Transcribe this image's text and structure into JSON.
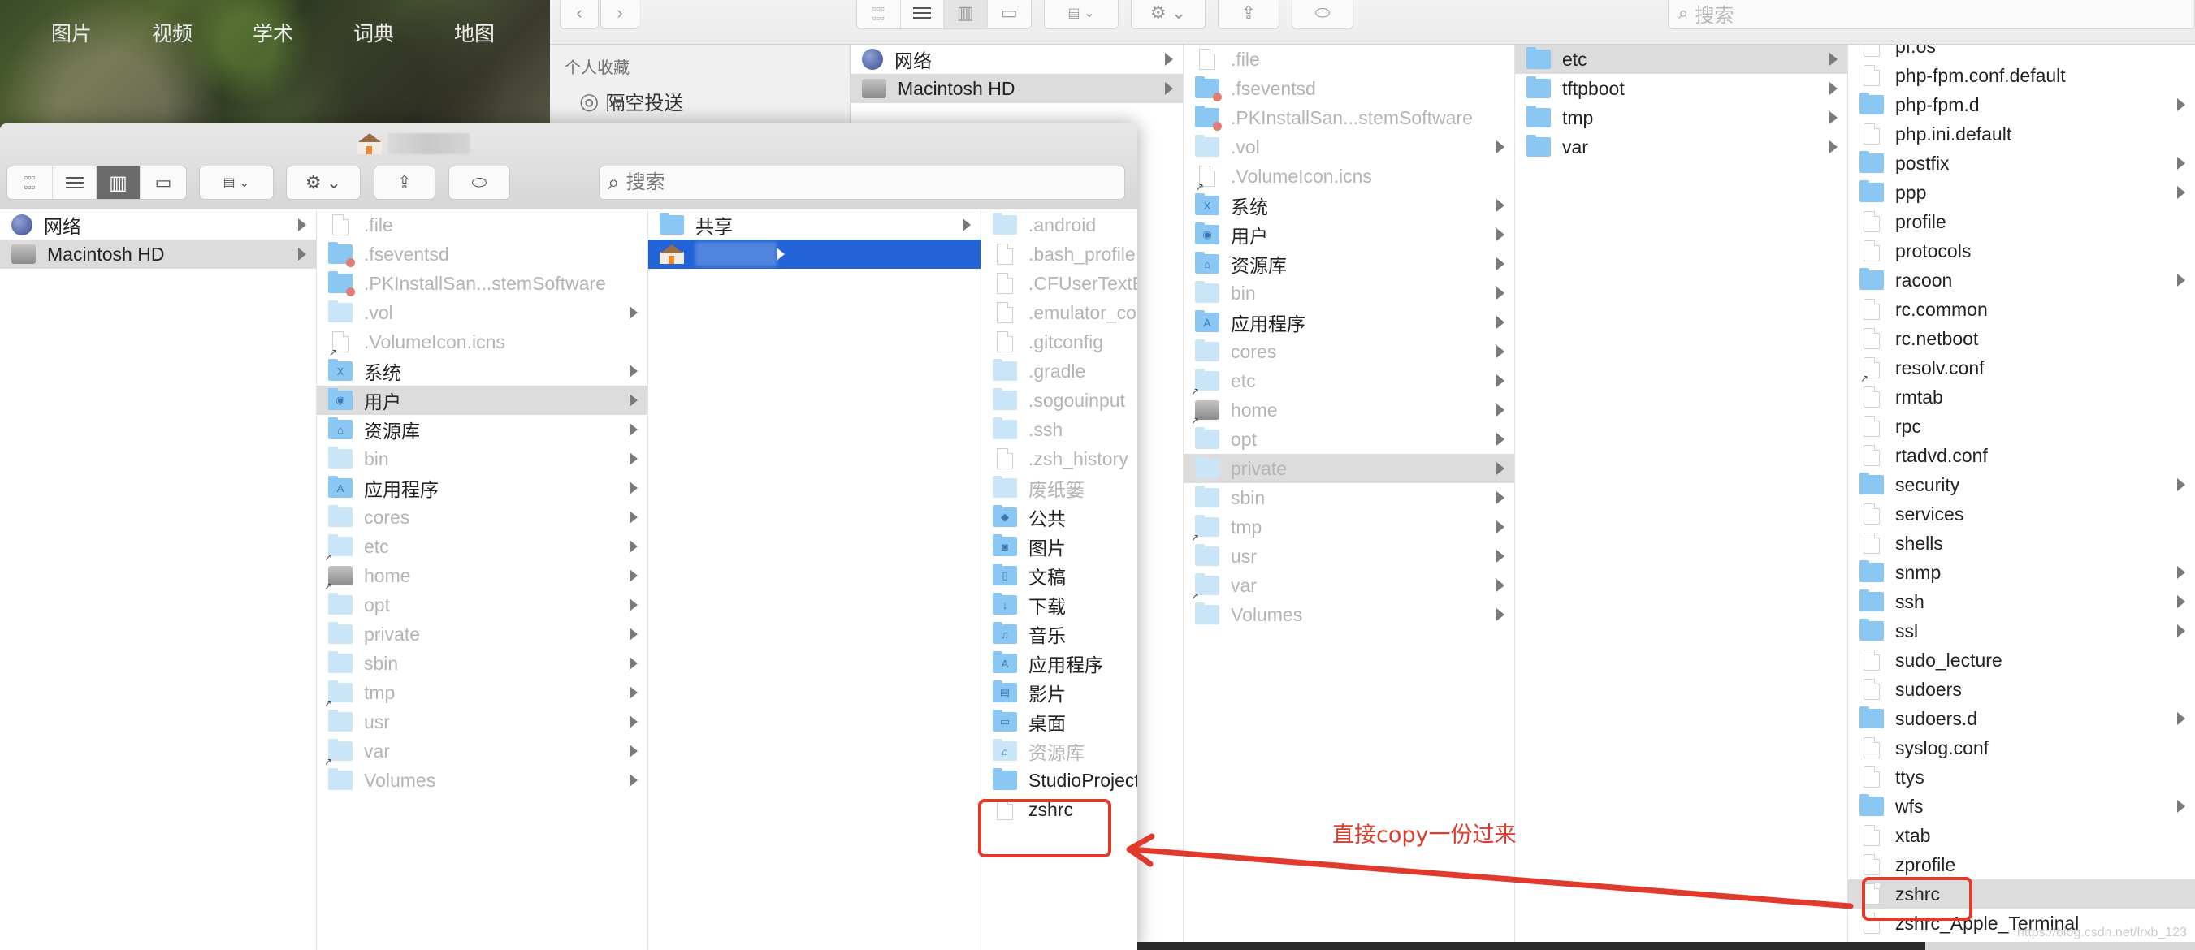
{
  "web_nav": [
    "图片",
    "视频",
    "学术",
    "词典",
    "地图"
  ],
  "back_window": {
    "search_placeholder": "搜索",
    "sidebar": {
      "section_title": "个人收藏",
      "items": [
        {
          "label": "隔空投送",
          "icon": "airdrop-icon"
        }
      ]
    },
    "columns": [
      [
        {
          "label": "网络",
          "icon": "globe",
          "arrow": true
        },
        {
          "label": "Macintosh HD",
          "icon": "disk",
          "arrow": true,
          "state": "gray"
        }
      ],
      [
        {
          "label": ".file",
          "icon": "file",
          "dim": true
        },
        {
          "label": ".fseventsd",
          "icon": "folder-blocked",
          "dim": true
        },
        {
          "label": ".PKInstallSan...stemSoftware",
          "icon": "folder-blocked",
          "dim": true
        },
        {
          "label": ".vol",
          "icon": "folder-light",
          "dim": true,
          "arrow": true
        },
        {
          "label": ".VolumeIcon.icns",
          "icon": "file-alias",
          "dim": true
        },
        {
          "label": "系统",
          "icon": "folder",
          "glyph": "X",
          "arrow": true
        },
        {
          "label": "用户",
          "icon": "folder",
          "glyph": "◉",
          "arrow": true
        },
        {
          "label": "资源库",
          "icon": "folder",
          "glyph": "⌂",
          "arrow": true
        },
        {
          "label": "bin",
          "icon": "folder-light",
          "dim": true,
          "arrow": true
        },
        {
          "label": "应用程序",
          "icon": "folder",
          "glyph": "A",
          "arrow": true
        },
        {
          "label": "cores",
          "icon": "folder-light",
          "dim": true,
          "arrow": true
        },
        {
          "label": "etc",
          "icon": "folder-light-alias",
          "dim": true,
          "arrow": true
        },
        {
          "label": "home",
          "icon": "disk-alias",
          "dim": true,
          "arrow": true
        },
        {
          "label": "opt",
          "icon": "folder-light",
          "dim": true,
          "arrow": true
        },
        {
          "label": "private",
          "icon": "folder-light",
          "dim": true,
          "arrow": true,
          "state": "gray"
        },
        {
          "label": "sbin",
          "icon": "folder-light",
          "dim": true,
          "arrow": true
        },
        {
          "label": "tmp",
          "icon": "folder-light-alias",
          "dim": true,
          "arrow": true
        },
        {
          "label": "usr",
          "icon": "folder-light",
          "dim": true,
          "arrow": true
        },
        {
          "label": "var",
          "icon": "folder-light-alias",
          "dim": true,
          "arrow": true
        },
        {
          "label": "Volumes",
          "icon": "folder-light",
          "dim": true,
          "arrow": true
        }
      ],
      [
        {
          "label": "etc",
          "icon": "folder",
          "arrow": true,
          "state": "gray"
        },
        {
          "label": "tftpboot",
          "icon": "folder",
          "arrow": true
        },
        {
          "label": "tmp",
          "icon": "folder",
          "arrow": true
        },
        {
          "label": "var",
          "icon": "folder",
          "arrow": true
        }
      ],
      [
        {
          "label": "pf.os",
          "icon": "file"
        },
        {
          "label": "php-fpm.conf.default",
          "icon": "file"
        },
        {
          "label": "php-fpm.d",
          "icon": "folder",
          "arrow": true
        },
        {
          "label": "php.ini.default",
          "icon": "file"
        },
        {
          "label": "postfix",
          "icon": "folder",
          "arrow": true
        },
        {
          "label": "ppp",
          "icon": "folder",
          "arrow": true
        },
        {
          "label": "profile",
          "icon": "file"
        },
        {
          "label": "protocols",
          "icon": "file"
        },
        {
          "label": "racoon",
          "icon": "folder",
          "arrow": true
        },
        {
          "label": "rc.common",
          "icon": "file"
        },
        {
          "label": "rc.netboot",
          "icon": "file"
        },
        {
          "label": "resolv.conf",
          "icon": "file-alias"
        },
        {
          "label": "rmtab",
          "icon": "file"
        },
        {
          "label": "rpc",
          "icon": "file"
        },
        {
          "label": "rtadvd.conf",
          "icon": "file"
        },
        {
          "label": "security",
          "icon": "folder",
          "arrow": true
        },
        {
          "label": "services",
          "icon": "file"
        },
        {
          "label": "shells",
          "icon": "file"
        },
        {
          "label": "snmp",
          "icon": "folder",
          "arrow": true
        },
        {
          "label": "ssh",
          "icon": "folder",
          "arrow": true
        },
        {
          "label": "ssl",
          "icon": "folder",
          "arrow": true
        },
        {
          "label": "sudo_lecture",
          "icon": "file"
        },
        {
          "label": "sudoers",
          "icon": "file"
        },
        {
          "label": "sudoers.d",
          "icon": "folder",
          "arrow": true
        },
        {
          "label": "syslog.conf",
          "icon": "file"
        },
        {
          "label": "ttys",
          "icon": "file"
        },
        {
          "label": "wfs",
          "icon": "folder",
          "arrow": true
        },
        {
          "label": "xtab",
          "icon": "file"
        },
        {
          "label": "zprofile",
          "icon": "file"
        },
        {
          "label": "zshrc",
          "icon": "file",
          "state": "gray"
        },
        {
          "label": "zshrc_Apple_Terminal",
          "icon": "file"
        }
      ]
    ]
  },
  "front_window": {
    "search_placeholder": "搜索",
    "columns": [
      [
        {
          "label": "网络",
          "icon": "globe",
          "arrow": true
        },
        {
          "label": "Macintosh HD",
          "icon": "disk",
          "arrow": true,
          "state": "gray"
        }
      ],
      [
        {
          "label": ".file",
          "icon": "file",
          "dim": true
        },
        {
          "label": ".fseventsd",
          "icon": "folder-blocked",
          "dim": true
        },
        {
          "label": ".PKInstallSan...stemSoftware",
          "icon": "folder-blocked",
          "dim": true
        },
        {
          "label": ".vol",
          "icon": "folder-light",
          "dim": true,
          "arrow": true
        },
        {
          "label": ".VolumeIcon.icns",
          "icon": "file-alias",
          "dim": true
        },
        {
          "label": "系统",
          "icon": "folder",
          "glyph": "X",
          "arrow": true
        },
        {
          "label": "用户",
          "icon": "folder",
          "glyph": "◉",
          "arrow": true,
          "state": "gray"
        },
        {
          "label": "资源库",
          "icon": "folder",
          "glyph": "⌂",
          "arrow": true
        },
        {
          "label": "bin",
          "icon": "folder-light",
          "dim": true,
          "arrow": true
        },
        {
          "label": "应用程序",
          "icon": "folder",
          "glyph": "A",
          "arrow": true
        },
        {
          "label": "cores",
          "icon": "folder-light",
          "dim": true,
          "arrow": true
        },
        {
          "label": "etc",
          "icon": "folder-light-alias",
          "dim": true,
          "arrow": true
        },
        {
          "label": "home",
          "icon": "disk-alias",
          "dim": true,
          "arrow": true
        },
        {
          "label": "opt",
          "icon": "folder-light",
          "dim": true,
          "arrow": true
        },
        {
          "label": "private",
          "icon": "folder-light",
          "dim": true,
          "arrow": true
        },
        {
          "label": "sbin",
          "icon": "folder-light",
          "dim": true,
          "arrow": true
        },
        {
          "label": "tmp",
          "icon": "folder-light-alias",
          "dim": true,
          "arrow": true
        },
        {
          "label": "usr",
          "icon": "folder-light",
          "dim": true,
          "arrow": true
        },
        {
          "label": "var",
          "icon": "folder-light-alias",
          "dim": true,
          "arrow": true
        },
        {
          "label": "Volumes",
          "icon": "folder-light",
          "dim": true,
          "arrow": true
        }
      ],
      [
        {
          "label": "共享",
          "icon": "folder",
          "arrow": true
        },
        {
          "label": "",
          "icon": "home",
          "arrow": true,
          "state": "blue",
          "redacted": true
        }
      ],
      [
        {
          "label": ".android",
          "icon": "folder-light",
          "dim": true
        },
        {
          "label": ".bash_profile",
          "icon": "file",
          "dim": true
        },
        {
          "label": ".CFUserTextEncoding",
          "icon": "file",
          "dim": true
        },
        {
          "label": ".emulator_console_auth_token",
          "icon": "file",
          "dim": true
        },
        {
          "label": ".gitconfig",
          "icon": "file",
          "dim": true
        },
        {
          "label": ".gradle",
          "icon": "folder-light",
          "dim": true
        },
        {
          "label": ".sogouinput",
          "icon": "folder-light",
          "dim": true
        },
        {
          "label": ".ssh",
          "icon": "folder-light",
          "dim": true
        },
        {
          "label": ".zsh_history",
          "icon": "file",
          "dim": true
        },
        {
          "label": "废纸篓",
          "icon": "folder-light",
          "dim": true
        },
        {
          "label": "公共",
          "icon": "folder",
          "glyph": "◆"
        },
        {
          "label": "图片",
          "icon": "folder",
          "glyph": "◙"
        },
        {
          "label": "文稿",
          "icon": "folder",
          "glyph": "▯"
        },
        {
          "label": "下载",
          "icon": "folder",
          "glyph": "↓"
        },
        {
          "label": "音乐",
          "icon": "folder",
          "glyph": "♫"
        },
        {
          "label": "应用程序",
          "icon": "folder",
          "glyph": "A"
        },
        {
          "label": "影片",
          "icon": "folder",
          "glyph": "▤"
        },
        {
          "label": "桌面",
          "icon": "folder",
          "glyph": "▭"
        },
        {
          "label": "资源库",
          "icon": "folder-light",
          "glyph": "⌂",
          "dim": true
        },
        {
          "label": "StudioProjects",
          "icon": "folder"
        },
        {
          "label": "zshrc",
          "icon": "file"
        }
      ]
    ]
  },
  "annotation": {
    "text": "直接copy一份过来",
    "color": "#e03a2c"
  },
  "watermark": "https://blog.csdn.net/lrxb_123",
  "colors": {
    "selection_blue": "#2264d7",
    "selection_gray": "#dcdcdc",
    "folder_blue": "#8ac7f2"
  }
}
